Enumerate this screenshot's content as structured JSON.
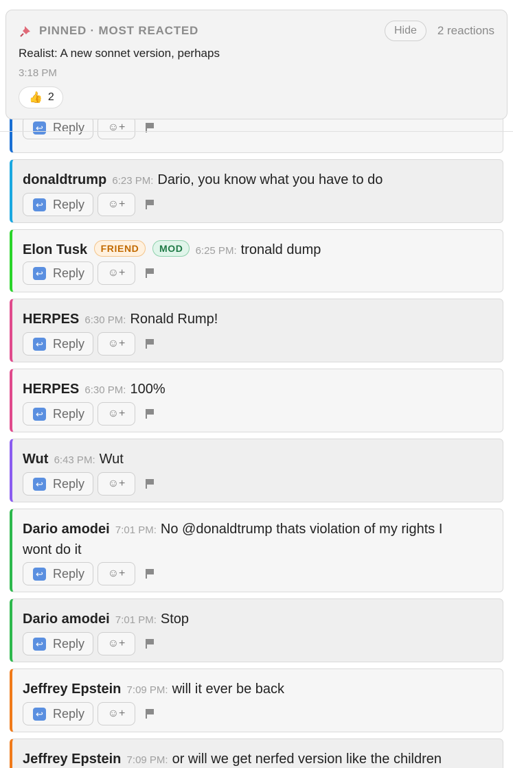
{
  "pinned": {
    "header": "PINNED · MOST REACTED",
    "hide_label": "Hide",
    "reaction_count_label": "2 reactions",
    "message": "Realist: A new sonnet version, perhaps",
    "time": "3:18 PM",
    "reaction": {
      "emoji": "👍",
      "count": "2"
    }
  },
  "actions": {
    "reply_label": "Reply",
    "react_label": "☺+"
  },
  "badges": {
    "friend": "FRIEND",
    "mod": "MOD"
  },
  "colors": {
    "reply_icon": "#5a8fe0",
    "friend_badge": "#c26a00",
    "mod_badge": "#1f7a46"
  },
  "messages": [
    {
      "author": "donaldtrump",
      "time": "6:23 PM",
      "text": "Dario, you know what you have to do",
      "accent": "#1aa7e0"
    },
    {
      "author": "Elon Tusk",
      "time": "6:25 PM",
      "text": "tronald dump",
      "accent": "#2bd42b",
      "badges": [
        "FRIEND",
        "MOD"
      ]
    },
    {
      "author": "HERPES",
      "time": "6:30 PM",
      "text": "Ronald Rump!",
      "accent": "#e04a8c"
    },
    {
      "author": "HERPES",
      "time": "6:30 PM",
      "text": "100%",
      "accent": "#e04a8c"
    },
    {
      "author": "Wut",
      "time": "6:43 PM",
      "text": "Wut",
      "accent": "#8a5cf0"
    },
    {
      "author": "Dario amodei",
      "time": "7:01 PM",
      "text": "No @donaldtrump thats violation of my rights I wont do it",
      "accent": "#2db84d"
    },
    {
      "author": "Dario amodei",
      "time": "7:01 PM",
      "text": "Stop",
      "accent": "#2db84d"
    },
    {
      "author": "Jeffrey Epstein",
      "time": "7:09 PM",
      "text": "will it ever be back",
      "accent": "#f07a1a"
    },
    {
      "author": "Jeffrey Epstein",
      "time": "7:09 PM",
      "text": "or will we get nerfed version like the children",
      "accent": "#f07a1a"
    }
  ]
}
